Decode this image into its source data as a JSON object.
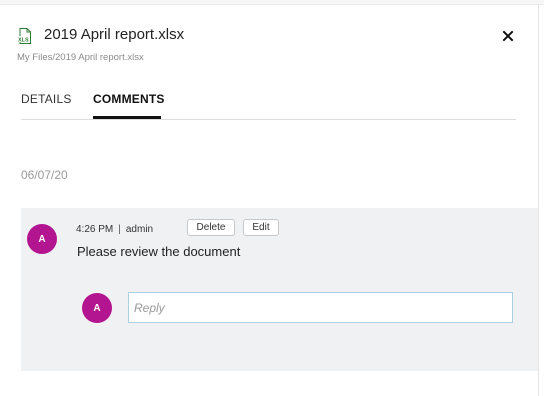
{
  "file": {
    "icon": "xlsx-file-icon",
    "icon_label": "XLS",
    "icon_color": "#2e7d32",
    "title": "2019 April report.xlsx",
    "path": "My Files/2019 April report.xlsx"
  },
  "close_icon": "close-icon",
  "tabs": [
    {
      "label": "DETAILS",
      "active": false
    },
    {
      "label": "COMMENTS",
      "active": true
    }
  ],
  "date_group": "06/07/20",
  "comment": {
    "avatar_initial": "A",
    "avatar_color": "#b3148f",
    "time": "4:26 PM",
    "separator": "|",
    "author": "admin",
    "delete_label": "Delete",
    "edit_label": "Edit",
    "text": "Please review the document"
  },
  "reply": {
    "avatar_initial": "A",
    "placeholder": "Reply",
    "value": ""
  }
}
